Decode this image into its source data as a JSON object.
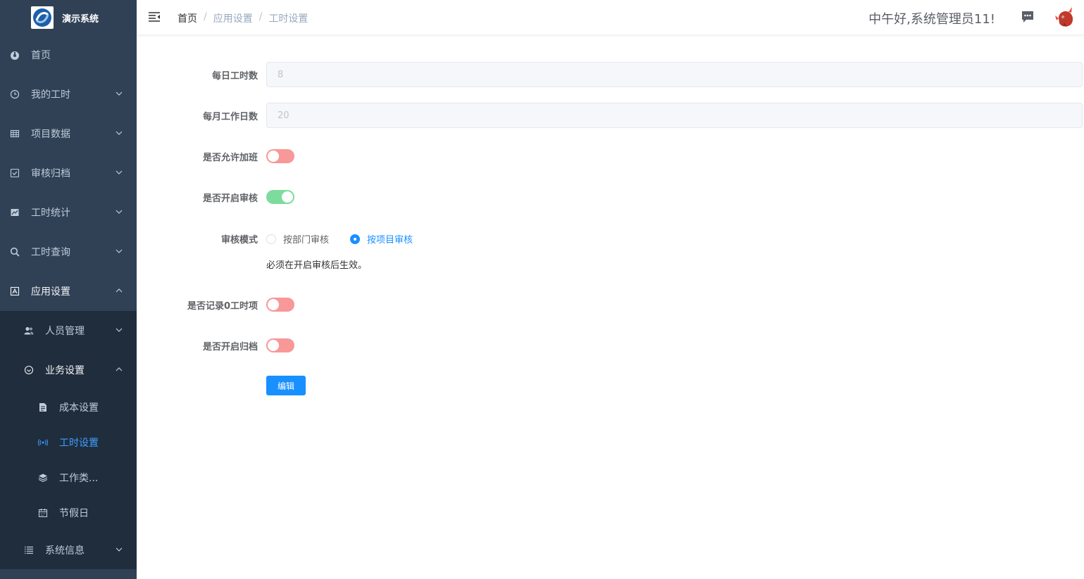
{
  "app": {
    "title": "演示系统"
  },
  "sidebar": {
    "items": [
      {
        "label": "首页",
        "icon": "dashboard-icon"
      },
      {
        "label": "我的工时",
        "icon": "clock-icon"
      },
      {
        "label": "项目数据",
        "icon": "table-icon"
      },
      {
        "label": "审核归档",
        "icon": "checkbox-icon"
      },
      {
        "label": "工时统计",
        "icon": "chart-icon"
      },
      {
        "label": "工时查询",
        "icon": "search-icon"
      },
      {
        "label": "应用设置",
        "icon": "settings-icon"
      }
    ],
    "sub": {
      "personnel": "人员管理",
      "business": "业务设置",
      "cost": "成本设置",
      "worktime": "工时设置",
      "worktype": "工作类...",
      "holiday": "节假日",
      "sysinfo": "系统信息"
    }
  },
  "header": {
    "breadcrumb": [
      "首页",
      "应用设置",
      "工时设置"
    ],
    "separator": "/",
    "greeting": "中午好,系统管理员11!"
  },
  "form": {
    "daily_hours_label": "每日工时数",
    "daily_hours_value": "8",
    "monthly_days_label": "每月工作日数",
    "monthly_days_value": "20",
    "allow_overtime_label": "是否允许加班",
    "allow_overtime": false,
    "enable_review_label": "是否开启审核",
    "enable_review": true,
    "review_mode_label": "审核模式",
    "review_mode_options": [
      "按部门审核",
      "按项目审核"
    ],
    "review_mode_selected": "按项目审核",
    "review_hint": "必须在开启审核后生效。",
    "record_zero_label": "是否记录0工时项",
    "record_zero": false,
    "enable_archive_label": "是否开启归档",
    "enable_archive": false,
    "edit_button": "编辑"
  },
  "colors": {
    "sidebar_bg": "#304156",
    "submenu_bg": "#1f2d3d",
    "active": "#409eff",
    "primary": "#1890ff",
    "switch_on": "#7ddc9d",
    "switch_off": "#f89898"
  }
}
